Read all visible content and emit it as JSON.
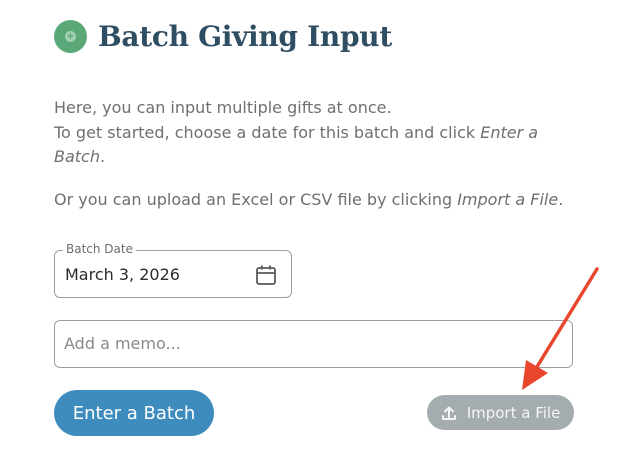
{
  "header": {
    "title": "Batch Giving Input",
    "icon": "plus-circle-icon",
    "icon_color": "#5aa877"
  },
  "intro": {
    "line1": "Here, you can input multiple gifts at once.",
    "line2_prefix": "To get started, choose a date for this batch and click ",
    "line2_emphasis": "Enter a Batch",
    "line2_suffix": ".",
    "line3_prefix": "Or you can upload an Excel or CSV file by clicking ",
    "line3_emphasis": "Import a File",
    "line3_suffix": "."
  },
  "batch_date": {
    "label": "Batch Date",
    "value": "March 3, 2026",
    "icon": "calendar-icon"
  },
  "memo": {
    "placeholder": "Add a memo..."
  },
  "buttons": {
    "enter_batch": "Enter a Batch",
    "import_file": "Import a File",
    "import_icon": "upload-icon",
    "primary_color": "#3d8cbd",
    "disabled_color": "#a4acaf"
  },
  "annotation": {
    "arrow_color": "#e8472d",
    "icon": "red-arrow-icon"
  }
}
